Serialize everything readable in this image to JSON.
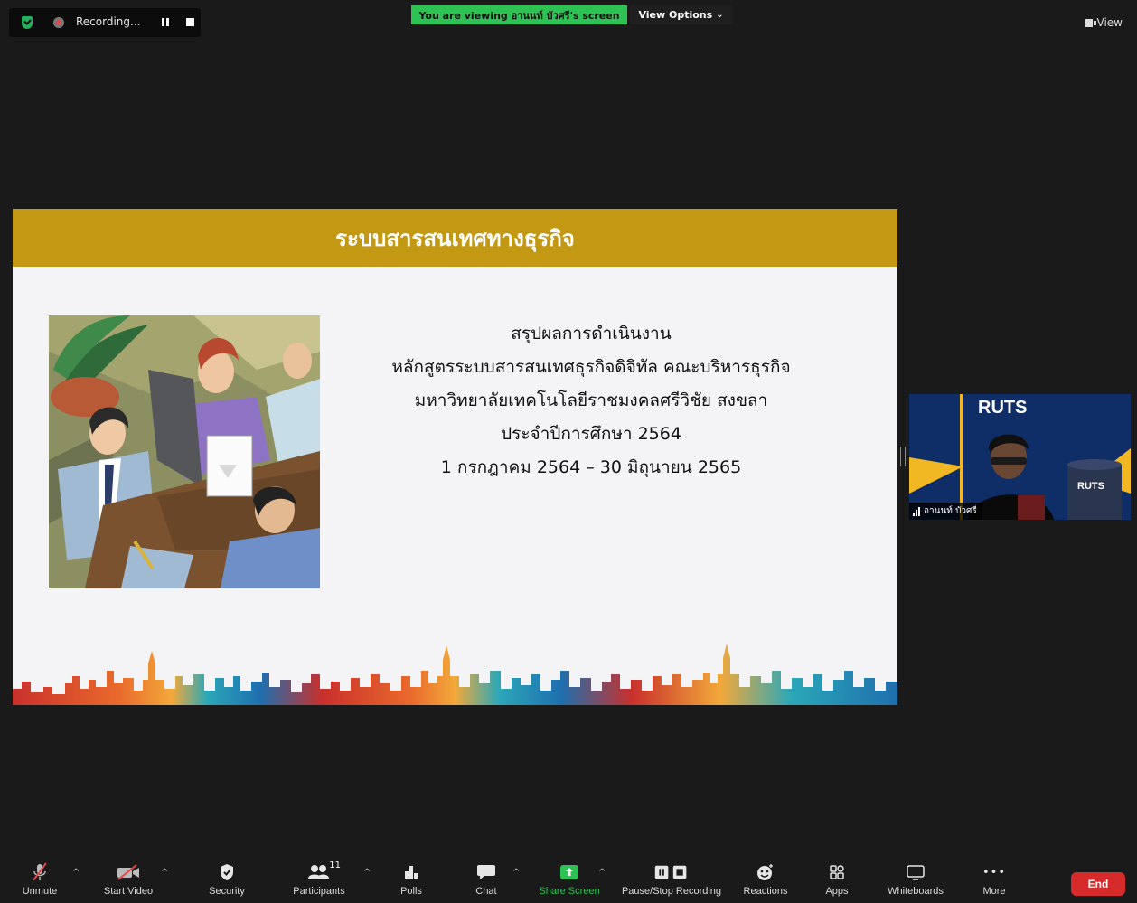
{
  "top_bar": {
    "recording_label": "Recording...",
    "viewing_banner": "You are viewing อานนท์ บัวศรี's screen",
    "view_options_label": "View Options",
    "view_options_chevron": "⌄",
    "view_label": "View"
  },
  "slide": {
    "header_title": "ระบบสารสนเทศทางธุรกิจ",
    "lines": [
      "สรุปผลการดำเนินงาน",
      "หลักสูตรระบบสารสนเทศธุรกิจดิจิทัล คณะบริหารธุรกิจ",
      "มหาวิทยาลัยเทคโนโลยีราชมงคลศรีวิชัย สงขลา",
      "ประจำปีการศึกษา 2564",
      "1 กรกฎาคม 2564 – 30 มิถุนายน 2565"
    ],
    "header_color": "#c39812"
  },
  "video": {
    "participant_name": "อานนท์ บัวศรี",
    "backdrop_text": "RUTS",
    "backdrop_small_text": "RUTS"
  },
  "toolbar": {
    "unmute_label": "Unmute",
    "start_video_label": "Start Video",
    "security_label": "Security",
    "participants_label": "Participants",
    "participants_count": "11",
    "polls_label": "Polls",
    "chat_label": "Chat",
    "share_screen_label": "Share Screen",
    "pause_stop_recording_label": "Pause/Stop Recording",
    "reactions_label": "Reactions",
    "apps_label": "Apps",
    "whiteboards_label": "Whiteboards",
    "more_label": "More",
    "more_dots": "•••",
    "caret": "^",
    "end_label": "End"
  },
  "colors": {
    "accent_green": "#2dc253",
    "end_red": "#d72a2a",
    "background": "#1a1a1a"
  },
  "icons": [
    "shield-icon",
    "record-dot-icon",
    "pause-icon",
    "stop-icon",
    "chevron-down-icon",
    "view-icon",
    "muted-mic-icon",
    "video-off-icon",
    "shield-outline-icon",
    "people-icon",
    "polls-icon",
    "chat-icon",
    "share-arrow-icon",
    "pause-stop-icon",
    "reaction-smile-icon",
    "apps-icon",
    "whiteboard-icon",
    "more-dots-icon",
    "signal-bars-icon"
  ]
}
